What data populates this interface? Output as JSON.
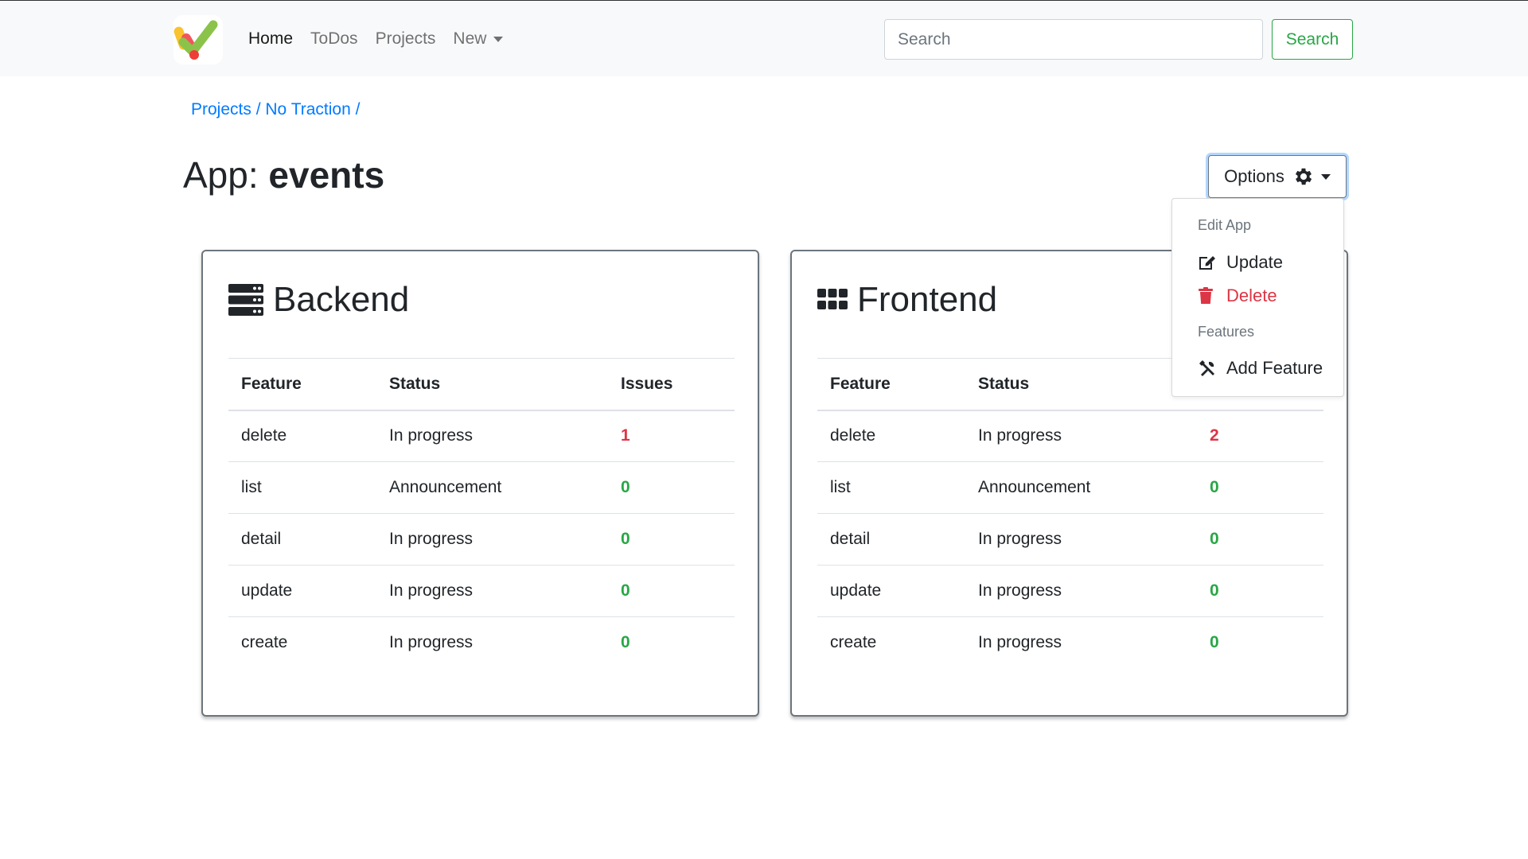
{
  "nav": {
    "links": [
      "Home",
      "ToDos",
      "Projects",
      "New"
    ],
    "search_placeholder": "Search",
    "search_button": "Search"
  },
  "breadcrumb": [
    "Projects",
    "No Traction"
  ],
  "breadcrumb_sep": "/",
  "title": {
    "prefix": "App:",
    "name": "events"
  },
  "options": {
    "label": "Options",
    "menu": {
      "edit_header": "Edit App",
      "update": "Update",
      "delete": "Delete",
      "features_header": "Features",
      "add_feature": "Add Feature"
    }
  },
  "columns": [
    "Feature",
    "Status",
    "Issues"
  ],
  "backend": {
    "title": "Backend",
    "rows": [
      {
        "feature": "delete",
        "status": "In progress",
        "issues": "1"
      },
      {
        "feature": "list",
        "status": "Announcement",
        "issues": "0"
      },
      {
        "feature": "detail",
        "status": "In progress",
        "issues": "0"
      },
      {
        "feature": "update",
        "status": "In progress",
        "issues": "0"
      },
      {
        "feature": "create",
        "status": "In progress",
        "issues": "0"
      }
    ]
  },
  "frontend": {
    "title": "Frontend",
    "rows": [
      {
        "feature": "delete",
        "status": "In progress",
        "issues": "2"
      },
      {
        "feature": "list",
        "status": "Announcement",
        "issues": "0"
      },
      {
        "feature": "detail",
        "status": "In progress",
        "issues": "0"
      },
      {
        "feature": "update",
        "status": "In progress",
        "issues": "0"
      },
      {
        "feature": "create",
        "status": "In progress",
        "issues": "0"
      }
    ]
  },
  "colors": {
    "primary": "#007bff",
    "success": "#28a745",
    "danger": "#dc3545"
  },
  "icons": {
    "brand": "checkmark-logo-icon",
    "backend": "server-icon",
    "frontend": "grid-icon",
    "options": "gear-icon",
    "update": "edit-icon",
    "delete": "trash-icon",
    "add_feature": "tools-icon"
  }
}
